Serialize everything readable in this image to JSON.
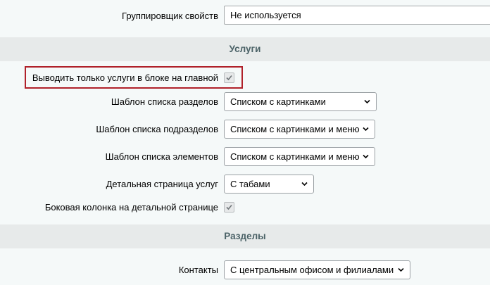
{
  "group_props": {
    "label": "Группировщик свойств",
    "value": "Не используется"
  },
  "services": {
    "header": "Услуги",
    "only_main": {
      "label": "Выводить только услуги в блоке на главной",
      "checked": true
    },
    "section_list_tpl": {
      "label": "Шаблон списка разделов",
      "value": "Списком с картинками"
    },
    "subsection_list_tpl": {
      "label": "Шаблон списка подразделов",
      "value": "Списком с картинками и меню"
    },
    "element_list_tpl": {
      "label": "Шаблон списка элементов",
      "value": "Списком с картинками и меню"
    },
    "detail_page": {
      "label": "Детальная страница услуг",
      "value": "С табами"
    },
    "side_column": {
      "label": "Боковая колонка на детальной странице",
      "checked": true
    }
  },
  "sections": {
    "header": "Разделы",
    "contacts": {
      "label": "Контакты",
      "value": "С центральным офисом и филиалами"
    }
  },
  "colors": {
    "highlight": "#b0212a",
    "section_bg": "#e7eaea",
    "section_text": "#4b6267"
  },
  "icons": {
    "select_arrow": "chevron-down-icon",
    "checkbox_mark": "check-icon"
  }
}
